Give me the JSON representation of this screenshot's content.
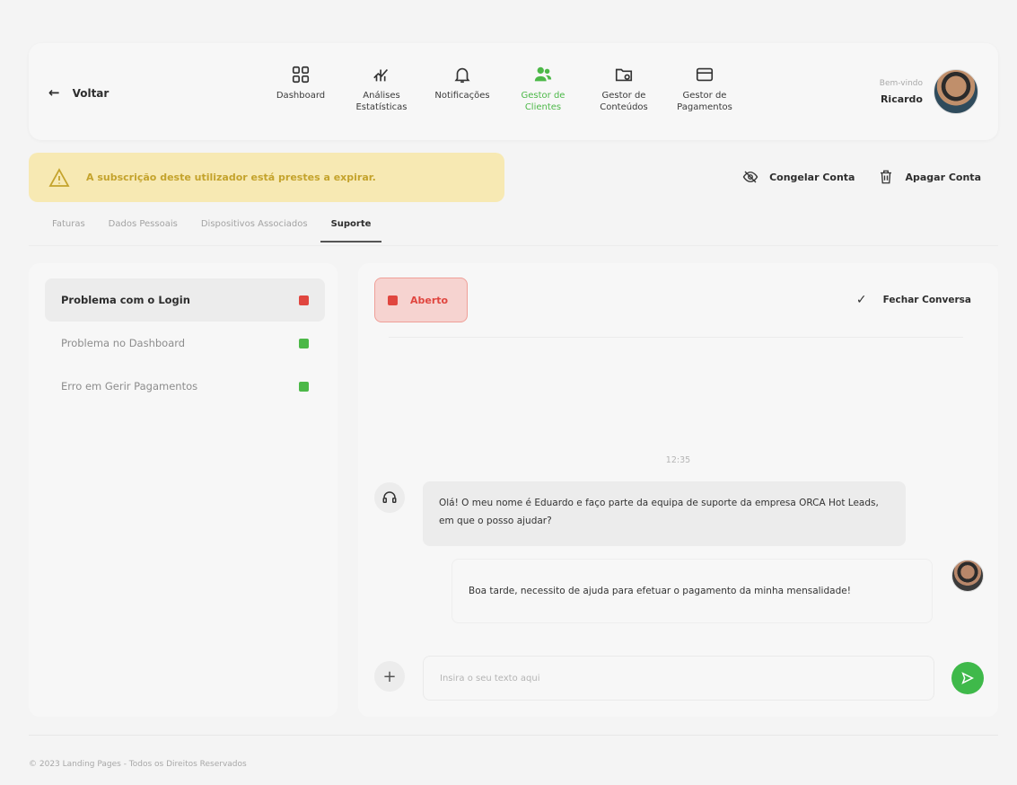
{
  "header": {
    "back_label": "Voltar",
    "nav": [
      {
        "label": "Dashboard",
        "icon": "grid-icon"
      },
      {
        "label": "Análises\nEstatísticas",
        "icon": "chart-icon"
      },
      {
        "label": "Notificações",
        "icon": "bell-icon"
      },
      {
        "label": "Gestor de\nClientes",
        "icon": "users-icon",
        "active": true
      },
      {
        "label": "Gestor de\nConteúdos",
        "icon": "folder-icon"
      },
      {
        "label": "Gestor de\nPagamentos",
        "icon": "card-icon"
      }
    ],
    "welcome": "Bem-vindo",
    "user_name": "Ricardo"
  },
  "warning": {
    "message": "A subscrição deste utilizador está prestes a expirar."
  },
  "account_actions": {
    "freeze": "Congelar Conta",
    "delete": "Apagar Conta"
  },
  "tabs": [
    {
      "label": "Faturas"
    },
    {
      "label": "Dados Pessoais"
    },
    {
      "label": "Dispositivos Associados"
    },
    {
      "label": "Suporte",
      "active": true
    }
  ],
  "tickets": [
    {
      "title": "Problema com o Login",
      "status_color": "#e0463f",
      "selected": true
    },
    {
      "title": "Problema no Dashboard",
      "status_color": "#4cb848"
    },
    {
      "title": "Erro em Gerir Pagamentos",
      "status_color": "#4cb848"
    }
  ],
  "chat": {
    "status_label": "Aberto",
    "close_label": "Fechar Conversa",
    "timestamp": "12:35",
    "messages": [
      {
        "from": "support",
        "text": "Olá! O meu nome é Eduardo e faço parte da equipa de suporte da empresa ORCA Hot Leads, em que o posso ajudar?"
      },
      {
        "from": "user",
        "text": "Boa tarde, necessito de ajuda para efetuar o pagamento da minha mensalidade!"
      }
    ],
    "input_placeholder": "Insira o seu texto aqui"
  },
  "footer": "© 2023 Landing Pages - Todos os Direitos Reservados",
  "colors": {
    "accent_green": "#4cb848",
    "alert_red": "#e0463f",
    "warning_bg": "#f7e9b3",
    "warning_text": "#c4a32c"
  }
}
